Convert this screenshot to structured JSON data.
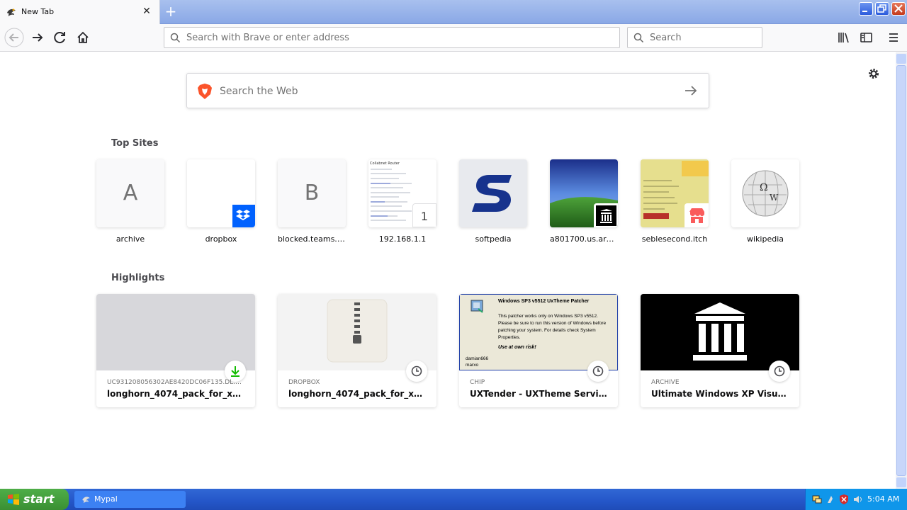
{
  "browser": {
    "tab_title": "New Tab",
    "url_placeholder": "Search with Brave or enter address",
    "search_placeholder": "Search"
  },
  "newtab": {
    "web_search_placeholder": "Search the Web",
    "top_sites_title": "Top Sites",
    "highlights_title": "Highlights",
    "top_sites": [
      {
        "label": "archive",
        "letter": "A"
      },
      {
        "label": "dropbox",
        "letter": ""
      },
      {
        "label": "blocked.teams.clo...",
        "letter": "B"
      },
      {
        "label": "192.168.1.1",
        "letter": ""
      },
      {
        "label": "softpedia",
        "letter": ""
      },
      {
        "label": "a801700.us.archi...",
        "letter": ""
      },
      {
        "label": "seblesecond.itch",
        "letter": ""
      },
      {
        "label": "wikipedia",
        "letter": ""
      }
    ],
    "highlights": [
      {
        "source": "UC931208056302AE8420DC06F135.DL.DRO...",
        "title": "longhorn_4074_pack_for_xp_v2_..."
      },
      {
        "source": "DROPBOX",
        "title": "longhorn_4074_pack_for_xp_v2_..."
      },
      {
        "source": "CHIP",
        "title": "UXTender - UXTheme Service P..."
      },
      {
        "source": "ARCHIVE",
        "title": "Ultimate Windows XP Visual The..."
      }
    ],
    "patcher_thumb": {
      "heading": "Windows SP3 v5512 UxTheme Patcher",
      "body": "This patcher works only on Windows SP3 v5512. Please be sure to run this version of Windows before patching your system. For details check System Properties.",
      "warning": "Use at own risk!",
      "credits": "damian666\nmarxo"
    },
    "router_thumb_heading": "Collabnet Router",
    "router_badge": "1"
  },
  "taskbar": {
    "start_label": "start",
    "task_label": "Mypal",
    "clock": "5:04 AM"
  },
  "colors": {
    "brave_orange": "#fb542b",
    "dropbox_blue": "#0061fe",
    "softpedia_blue": "#17338d",
    "xp_taskbar": "#2456c8"
  }
}
